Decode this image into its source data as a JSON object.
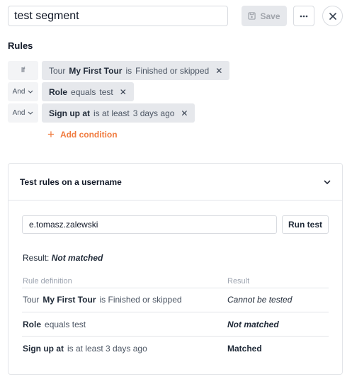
{
  "segment_name": "test segment",
  "save_label": "Save",
  "rules_title": "Rules",
  "rules": [
    {
      "connector": "If",
      "has_dropdown": false,
      "field": "Tour",
      "value_bold": "My First Tour",
      "operator": "is",
      "value": "Finished or skipped"
    },
    {
      "connector": "And",
      "has_dropdown": true,
      "field": "Role",
      "operator": "equals",
      "value": "test"
    },
    {
      "connector": "And",
      "has_dropdown": true,
      "field": "Sign up at",
      "operator": "is at least",
      "value": "3 days ago"
    }
  ],
  "add_condition_label": "Add condition",
  "test_panel": {
    "title": "Test rules on a username",
    "username_value": "e.tomasz.zalewski",
    "run_label": "Run test",
    "result_prefix": "Result:",
    "result_value": "Not matched",
    "col_definition": "Rule definition",
    "col_result": "Result",
    "rows": [
      {
        "field": "Tour",
        "value_bold": "My First Tour",
        "operator": "is",
        "value": "Finished or skipped",
        "result": "Cannot be tested",
        "result_style": "italic"
      },
      {
        "field": "Role",
        "operator": "equals",
        "value": "test",
        "result": "Not matched",
        "result_style": "bold-italic"
      },
      {
        "field": "Sign up at",
        "operator": "is at least",
        "value": "3 days ago",
        "result": "Matched",
        "result_style": "bold"
      }
    ]
  },
  "colors": {
    "accent": "#f07b3f",
    "chip_bg": "#e6e8ec",
    "border": "#d8dbe0"
  },
  "icons": {
    "save": "save-icon",
    "more": "more-icon",
    "close": "close-icon",
    "remove": "remove-icon",
    "chevron": "chevron-down-icon",
    "add": "plus-icon"
  }
}
